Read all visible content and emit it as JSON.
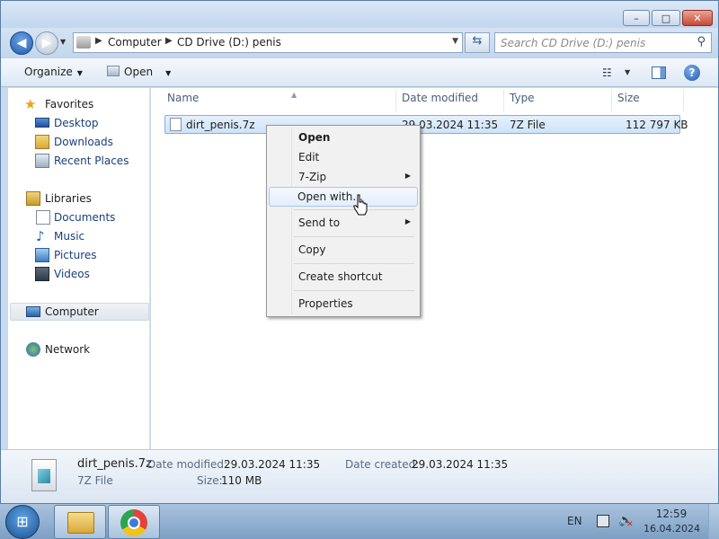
{
  "window": {
    "controls": {
      "minimize": "–",
      "maximize": "□",
      "close": "✕"
    }
  },
  "navigation": {
    "back_glyph": "◀",
    "forward_glyph": "▶",
    "address": {
      "segments": [
        "Computer",
        "CD Drive (D:) penis"
      ],
      "separator": "▶"
    },
    "search": {
      "placeholder": "Search CD Drive (D:) penis"
    }
  },
  "toolbar": {
    "organize": "Organize",
    "open": "Open"
  },
  "sidebar": {
    "favorites": {
      "label": "Favorites",
      "items": [
        "Desktop",
        "Downloads",
        "Recent Places"
      ]
    },
    "libraries": {
      "label": "Libraries",
      "items": [
        "Documents",
        "Music",
        "Pictures",
        "Videos"
      ]
    },
    "computer": {
      "label": "Computer"
    },
    "network": {
      "label": "Network"
    }
  },
  "file_list": {
    "columns": [
      "Name",
      "Date modified",
      "Type",
      "Size"
    ],
    "rows": [
      {
        "name": "dirt_penis.7z",
        "date": "29.03.2024 11:35",
        "type": "7Z File",
        "size": "112 797 KB"
      }
    ]
  },
  "context_menu": {
    "items": [
      {
        "label": "Open"
      },
      {
        "label": "Edit"
      },
      {
        "label": "7-Zip"
      },
      {
        "label": "Open with..."
      },
      {
        "label": "Send to"
      },
      {
        "label": "Copy"
      },
      {
        "label": "Create shortcut"
      },
      {
        "label": "Properties"
      }
    ]
  },
  "details_pane": {
    "filename": "dirt_penis.7z",
    "filetype": "7Z File",
    "date_modified_label": "Date modified:",
    "date_modified": "29.03.2024 11:35",
    "date_created_label": "Date created:",
    "date_created": "29.03.2024 11:35",
    "size_label": "Size:",
    "size": "110 MB"
  },
  "taskbar": {
    "language": "EN",
    "time": "12:59",
    "date": "16.04.2024"
  },
  "colors": {
    "selection_fill": "#cde3f8",
    "selection_border": "#7fb0e4",
    "link_text": "#1a3f7a",
    "window_frame": "#c9daee"
  },
  "icons": {
    "favorites": "star-icon",
    "desktop": "desktop-icon",
    "downloads": "downloads-folder-icon",
    "recent": "recent-places-icon",
    "libraries": "libraries-icon",
    "documents": "documents-icon",
    "music": "music-icon",
    "pictures": "pictures-icon",
    "videos": "videos-icon",
    "computer": "computer-icon",
    "network": "network-icon"
  }
}
